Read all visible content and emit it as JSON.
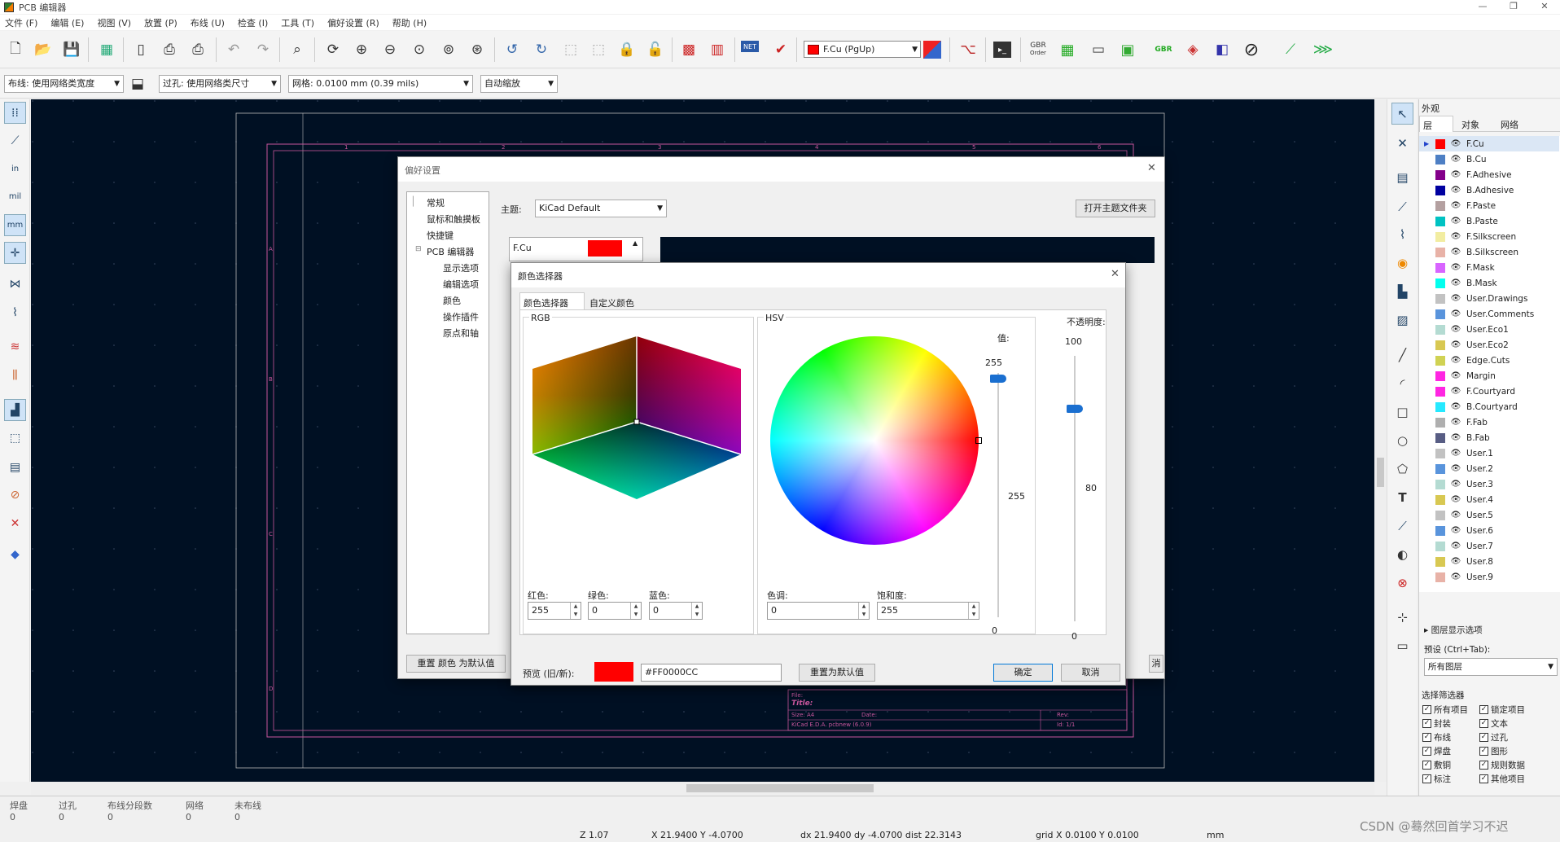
{
  "window": {
    "title": "PCB 编辑器",
    "controls": [
      "—",
      "❐",
      "✕"
    ]
  },
  "menu": [
    "文件 (F)",
    "编辑 (E)",
    "视图 (V)",
    "放置 (P)",
    "布线 (U)",
    "检查 (I)",
    "工具 (T)",
    "偏好设置 (R)",
    "帮助 (H)"
  ],
  "toolbar": {
    "active_layer": "F.Cu (PgUp)",
    "gbr_order": "GBR",
    "gbr_order_sub": "Order",
    "gbr_zip": "GBR",
    "net_label": "NET"
  },
  "toolbar2": {
    "track": "布线: 使用网络类宽度",
    "via": "过孔: 使用网络类尺寸",
    "grid": "网格: 0.0100 mm (0.39 mils)",
    "zoom": "自动缩放"
  },
  "left_tools": {
    "in": "in",
    "mil": "mil",
    "mm": "mm"
  },
  "canvas": {
    "col_labels": [
      "1",
      "2",
      "3",
      "4",
      "5",
      "6"
    ],
    "row_labels": [
      "A",
      "B",
      "C",
      "D"
    ],
    "titleblock": {
      "file": "File:",
      "title": "Title:",
      "size": "Size: A4",
      "date": "Date:",
      "rev": "Rev:",
      "kicad": "KiCad E.D.A.  pcbnew (6.0.9)",
      "id": "Id: 1/1"
    }
  },
  "appearance": {
    "title": "外观",
    "tabs": [
      "层",
      "对象",
      "网络"
    ],
    "layers": [
      {
        "name": "F.Cu",
        "color": "#ff0000"
      },
      {
        "name": "B.Cu",
        "color": "#4d7fc4"
      },
      {
        "name": "F.Adhesive",
        "color": "#84008a"
      },
      {
        "name": "B.Adhesive",
        "color": "#0000a0"
      },
      {
        "name": "F.Paste",
        "color": "#b4a0a0"
      },
      {
        "name": "B.Paste",
        "color": "#00c2c2"
      },
      {
        "name": "F.Silkscreen",
        "color": "#f2eda1"
      },
      {
        "name": "B.Silkscreen",
        "color": "#e8b2a7"
      },
      {
        "name": "F.Mask",
        "color": "#d864ff"
      },
      {
        "name": "B.Mask",
        "color": "#02ffee"
      },
      {
        "name": "User.Drawings",
        "color": "#c2c2c2"
      },
      {
        "name": "User.Comments",
        "color": "#5994dc"
      },
      {
        "name": "User.Eco1",
        "color": "#b4dbd2"
      },
      {
        "name": "User.Eco2",
        "color": "#d8c852"
      },
      {
        "name": "Edge.Cuts",
        "color": "#d0d253"
      },
      {
        "name": "Margin",
        "color": "#ff26e2"
      },
      {
        "name": "F.Courtyard",
        "color": "#ff26e2"
      },
      {
        "name": "B.Courtyard",
        "color": "#26e9ff"
      },
      {
        "name": "F.Fab",
        "color": "#afafaf"
      },
      {
        "name": "B.Fab",
        "color": "#585d84"
      },
      {
        "name": "User.1",
        "color": "#c2c2c2"
      },
      {
        "name": "User.2",
        "color": "#5994dc"
      },
      {
        "name": "User.3",
        "color": "#b4dbd2"
      },
      {
        "name": "User.4",
        "color": "#d8c852"
      },
      {
        "name": "User.5",
        "color": "#c2c2c2"
      },
      {
        "name": "User.6",
        "color": "#5994dc"
      },
      {
        "name": "User.7",
        "color": "#b4dbd2"
      },
      {
        "name": "User.8",
        "color": "#d8c852"
      },
      {
        "name": "User.9",
        "color": "#e8b2a7"
      }
    ],
    "layer_display": "图层显示选项",
    "preset_label": "预设 (Ctrl+Tab):",
    "preset_value": "所有图层"
  },
  "selection_filter": {
    "title": "选择筛选器",
    "items": [
      "所有项目",
      "锁定项目",
      "封装",
      "文本",
      "布线",
      "过孔",
      "焊盘",
      "图形",
      "敷铜",
      "规则数据",
      "标注",
      "其他项目"
    ]
  },
  "status": {
    "labels": [
      "焊盘",
      "过孔",
      "布线分段数",
      "网络",
      "未布线"
    ],
    "values": [
      "0",
      "0",
      "0",
      "0",
      "0"
    ],
    "z": "Z 1.07",
    "xy": "X 21.9400  Y -4.0700",
    "dxy": "dx 21.9400  dy -4.0700  dist 22.3143",
    "grid": "grid X 0.0100  Y 0.0100",
    "units": "mm",
    "watermark": "CSDN @蓦然回首学习不迟"
  },
  "prefs": {
    "title": "偏好设置",
    "tree": [
      "常规",
      "鼠标和触摸板",
      "快捷键",
      "PCB 编辑器",
      "显示选项",
      "编辑选项",
      "颜色",
      "操作插件",
      "原点和轴"
    ],
    "theme_label": "主题:",
    "theme_value": "KiCad Default",
    "open_theme_folder": "打开主题文件夹",
    "list_first": "F.Cu",
    "reset_btn": "重置 颜色 为默认值",
    "cancel_clip": "消"
  },
  "picker": {
    "title": "颜色选择器",
    "tabs": [
      "颜色选择器",
      "自定义颜色"
    ],
    "rgb_label": "RGB",
    "hsv_label": "HSV",
    "value_label": "值:",
    "value_top": "255",
    "value_mid": "255",
    "value_bottom": "0",
    "opacity_label": "不透明度:",
    "opacity_top": "100",
    "opacity_mid": "80",
    "opacity_bottom": "0",
    "red_label": "红色:",
    "green_label": "绿色:",
    "blue_label": "蓝色:",
    "red": "255",
    "green": "0",
    "blue": "0",
    "hue_label": "色调:",
    "sat_label": "饱和度:",
    "hue": "0",
    "sat": "255",
    "preview_label": "预览 (旧/新):",
    "hex": "#FF0000CC",
    "reset_default": "重置为默认值",
    "ok": "确定",
    "cancel": "取消",
    "preview_color": "#ff0000",
    "opacity_value": 80
  }
}
